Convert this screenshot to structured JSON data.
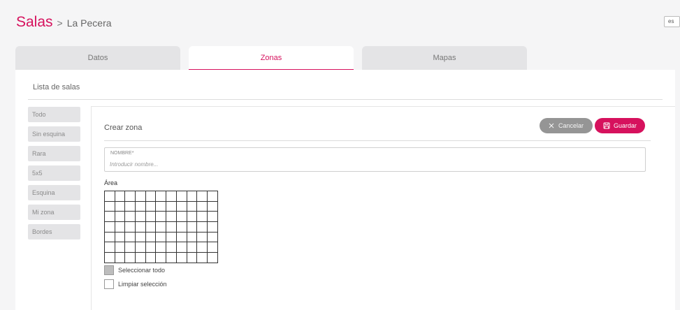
{
  "header": {
    "title": "Salas",
    "separator": ">",
    "subtitle": "La Pecera",
    "language": "es"
  },
  "tabs": [
    {
      "label": "Datos",
      "active": false
    },
    {
      "label": "Zonas",
      "active": true
    },
    {
      "label": "Mapas",
      "active": false
    }
  ],
  "list": {
    "title": "Lista de salas",
    "items": [
      "Todo",
      "Sin esquina",
      "Rara",
      "5x5",
      "Esquina",
      "Mi zona",
      "Bordes"
    ]
  },
  "form": {
    "title": "Crear zona",
    "cancel_label": "Cancelar",
    "save_label": "Guardar",
    "name_label": "NOMBRE*",
    "name_value": "",
    "name_placeholder": "Introducir nombre...",
    "area_label": "Área",
    "grid": {
      "columns": 11,
      "rows": 7
    },
    "select_all_label": "Seleccionar todo",
    "clear_selection_label": "Limpiar selección"
  },
  "colors": {
    "accent": "#d6115d",
    "cancel_button": "#959595",
    "tab_inactive": "#e4e4e6",
    "background": "#f5f5f6"
  },
  "icons": {
    "cancel": "close-icon",
    "save": "floppy-disk-icon"
  }
}
